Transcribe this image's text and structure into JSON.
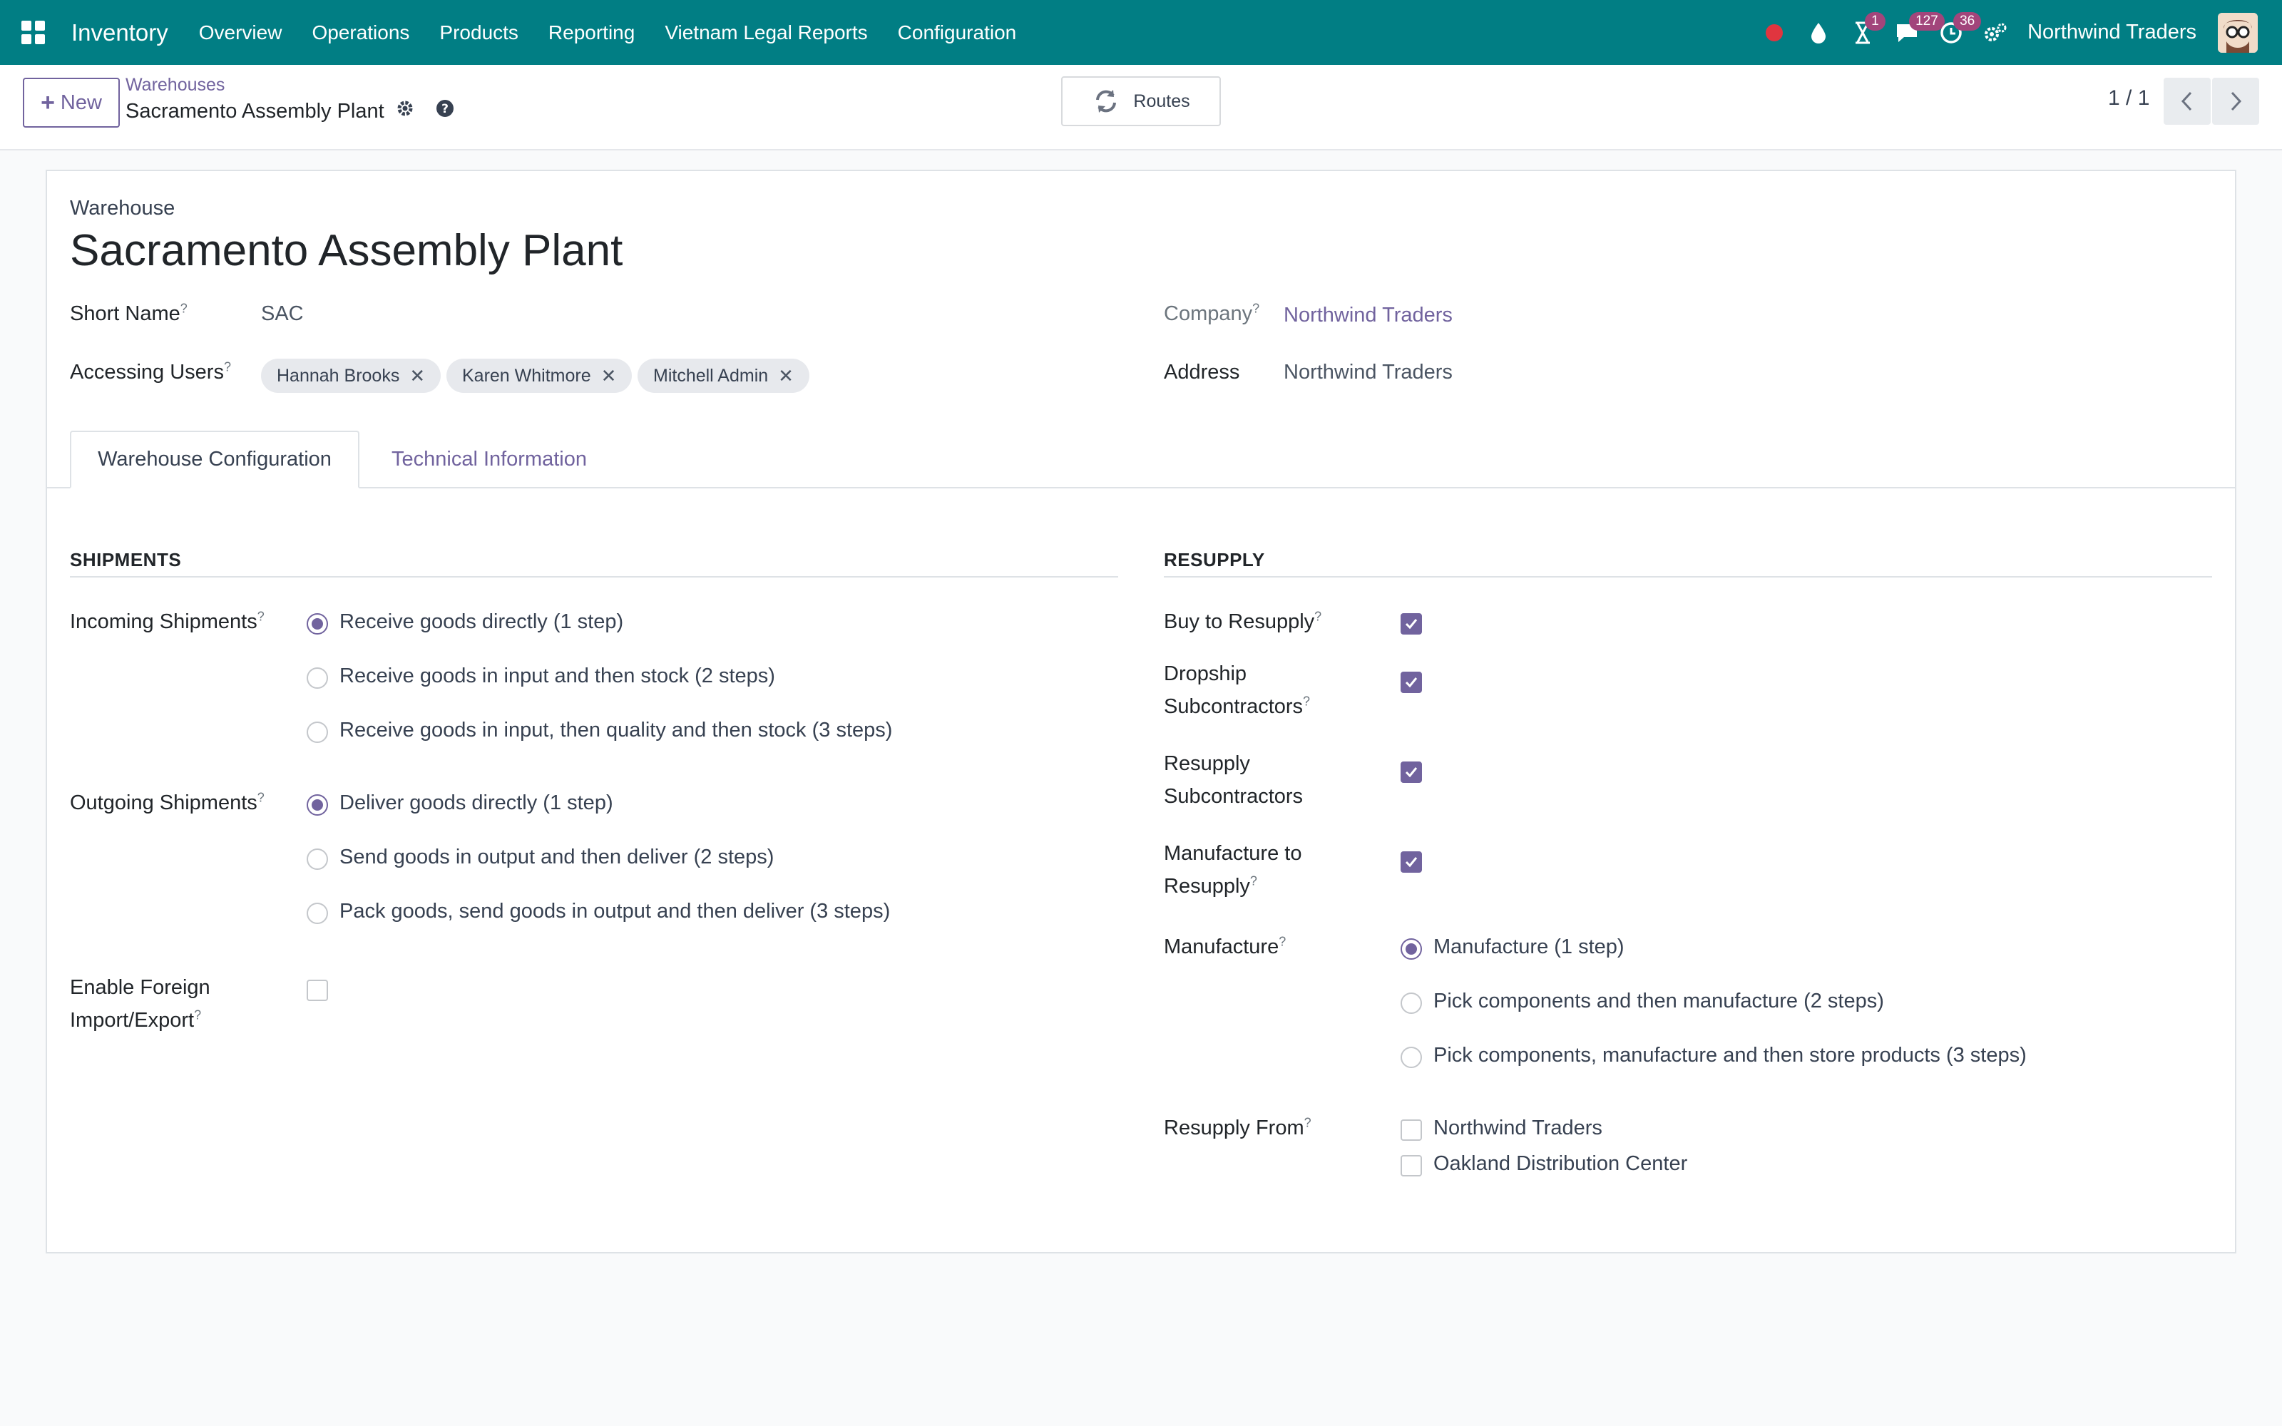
{
  "navbar": {
    "app_name": "Inventory",
    "menu": [
      "Overview",
      "Operations",
      "Products",
      "Reporting",
      "Vietnam Legal Reports",
      "Configuration"
    ],
    "activity_badge": "1",
    "messages_badge": "127",
    "clock_badge": "36",
    "company": "Northwind Traders"
  },
  "control_panel": {
    "new_label": "New",
    "breadcrumb_parent": "Warehouses",
    "breadcrumb_current": "Sacramento Assembly Plant",
    "routes_label": "Routes",
    "pager": "1 / 1"
  },
  "form": {
    "overline": "Warehouse",
    "title": "Sacramento Assembly Plant",
    "short_name_label": "Short Name",
    "short_name_value": "SAC",
    "accessing_users_label": "Accessing Users",
    "accessing_users": [
      "Hannah Brooks",
      "Karen Whitmore",
      "Mitchell Admin"
    ],
    "company_label": "Company",
    "company_value": "Northwind Traders",
    "address_label": "Address",
    "address_value": "Northwind Traders",
    "tabs": [
      "Warehouse Configuration",
      "Technical Information"
    ],
    "shipments": {
      "title": "SHIPMENTS",
      "incoming_label": "Incoming Shipments",
      "incoming_options": [
        "Receive goods directly (1 step)",
        "Receive goods in input and then stock (2 steps)",
        "Receive goods in input, then quality and then stock (3 steps)"
      ],
      "incoming_selected": 0,
      "outgoing_label": "Outgoing Shipments",
      "outgoing_options": [
        "Deliver goods directly (1 step)",
        "Send goods in output and then deliver (2 steps)",
        "Pack goods, send goods in output and then deliver (3 steps)"
      ],
      "outgoing_selected": 0,
      "foreign_label_1": "Enable Foreign",
      "foreign_label_2": "Import/Export",
      "foreign_checked": false
    },
    "resupply": {
      "title": "RESUPPLY",
      "buy_label": "Buy to Resupply",
      "buy_checked": true,
      "dropship_label_1": "Dropship",
      "dropship_label_2": "Subcontractors",
      "dropship_checked": true,
      "resupply_sub_label_1": "Resupply",
      "resupply_sub_label_2": "Subcontractors",
      "resupply_sub_checked": true,
      "manufacture_to_label_1": "Manufacture to",
      "manufacture_to_label_2": "Resupply",
      "manufacture_to_checked": true,
      "manufacture_label": "Manufacture",
      "manufacture_options": [
        "Manufacture (1 step)",
        "Pick components and then manufacture (2 steps)",
        "Pick components, manufacture and then store products (3 steps)"
      ],
      "manufacture_selected": 0,
      "resupply_from_label": "Resupply From",
      "resupply_from": [
        "Northwind Traders",
        "Oakland Distribution Center"
      ]
    }
  }
}
